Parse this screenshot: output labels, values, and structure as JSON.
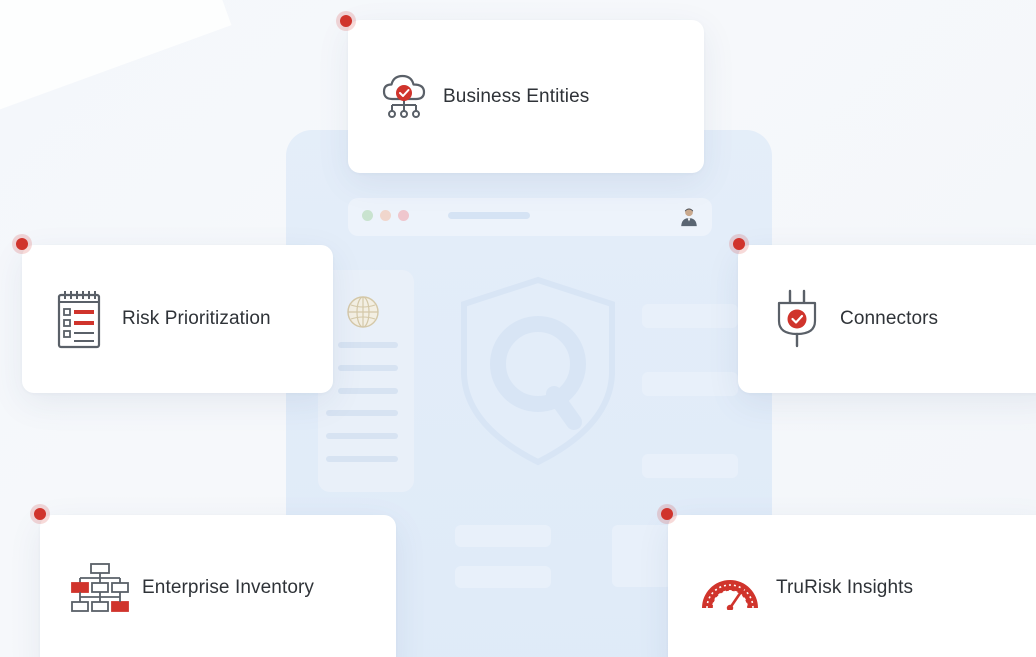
{
  "cards": {
    "business_entities": {
      "label": "Business Entities",
      "icon": "cloud-network-check-icon"
    },
    "risk_prioritization": {
      "label": "Risk Prioritization",
      "icon": "checklist-notepad-icon"
    },
    "connectors": {
      "label": "Connectors",
      "icon": "plug-check-icon"
    },
    "enterprise_inventory": {
      "label": "Enterprise Inventory",
      "icon": "org-chart-icon"
    },
    "trurisk_insights": {
      "label": "TruRisk Insights",
      "icon": "gauge-icon"
    }
  },
  "colors": {
    "accent_red": "#d0342c",
    "icon_gray": "#5a6068",
    "text": "#2f3338",
    "background": "#f4f7fb",
    "mock_window": "#e1ecf9"
  }
}
